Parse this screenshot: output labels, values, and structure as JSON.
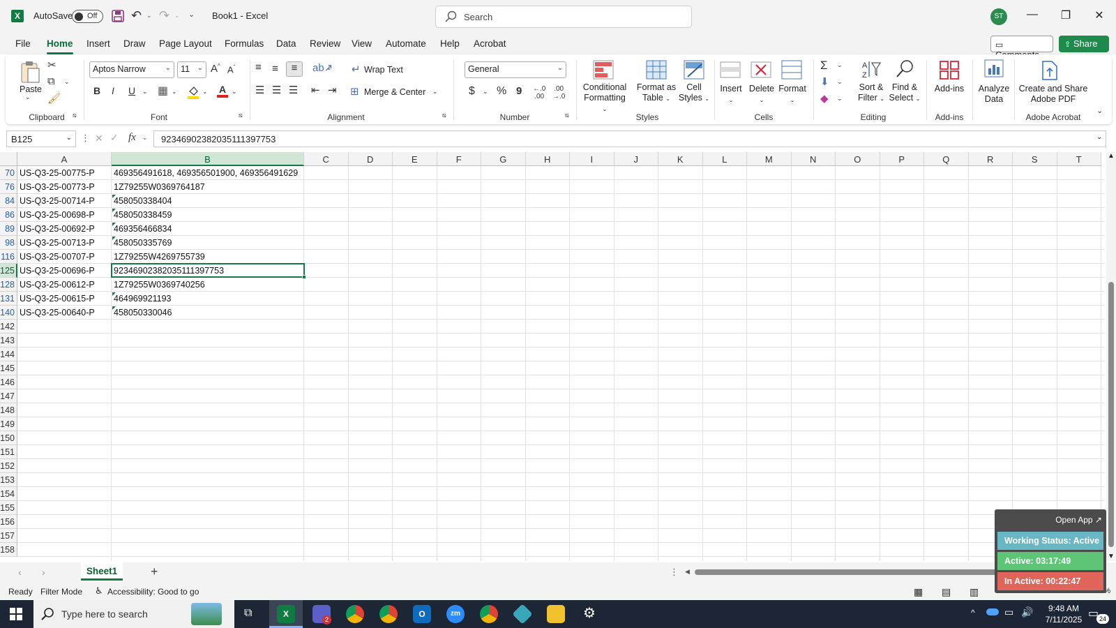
{
  "titlebar": {
    "autosave_label": "AutoSave",
    "autosave_state": "Off",
    "title": "Book1  -  Excel",
    "search_placeholder": "Search",
    "avatar_initials": "ST"
  },
  "menu": {
    "tabs": [
      "File",
      "Home",
      "Insert",
      "Draw",
      "Page Layout",
      "Formulas",
      "Data",
      "Review",
      "View",
      "Automate",
      "Help",
      "Acrobat"
    ],
    "active": "Home",
    "comments_label": "Comments",
    "share_label": "Share"
  },
  "ribbon": {
    "clipboard": {
      "paste": "Paste",
      "label": "Clipboard"
    },
    "font": {
      "name": "Aptos Narrow",
      "size": "11",
      "label": "Font",
      "bold": "B",
      "italic": "I",
      "underline": "U"
    },
    "alignment": {
      "wrap_text": "Wrap Text",
      "merge_center": "Merge & Center",
      "label": "Alignment"
    },
    "number": {
      "format": "General",
      "label": "Number",
      "currency": "$",
      "percent": "%",
      "comma": "9"
    },
    "styles": {
      "conditional_1": "Conditional",
      "conditional_2": "Formatting",
      "format_table_1": "Format as",
      "format_table_2": "Table",
      "cell_styles_1": "Cell",
      "cell_styles_2": "Styles",
      "label": "Styles"
    },
    "cells": {
      "insert": "Insert",
      "delete": "Delete",
      "format": "Format",
      "label": "Cells"
    },
    "editing": {
      "sort_1": "Sort &",
      "sort_2": "Filter",
      "find_1": "Find &",
      "find_2": "Select",
      "label": "Editing"
    },
    "addins": {
      "addins": "Add-ins",
      "label": "Add-ins"
    },
    "analyze": {
      "line1": "Analyze",
      "line2": "Data"
    },
    "acrobat": {
      "line1": "Create and Share",
      "line2": "Adobe PDF",
      "label": "Adobe Acrobat"
    }
  },
  "formula_bar": {
    "name_box": "B125",
    "fx": "fx",
    "value": "92346902382035111397753"
  },
  "columns": [
    "A",
    "B",
    "C",
    "D",
    "E",
    "F",
    "G",
    "H",
    "I",
    "J",
    "K",
    "L",
    "M",
    "N",
    "O",
    "P",
    "Q",
    "R",
    "S",
    "T"
  ],
  "selected_column": "B",
  "rows": [
    {
      "num": "70",
      "a": "US-Q3-25-00775-P",
      "b": "469356491618, 469356501900, 469356491629",
      "flag": false,
      "filtered": true
    },
    {
      "num": "76",
      "a": "US-Q3-25-00773-P",
      "b": "1Z79255W0369764187",
      "flag": false,
      "filtered": true
    },
    {
      "num": "84",
      "a": "US-Q3-25-00714-P",
      "b": "458050338404",
      "flag": true,
      "filtered": true
    },
    {
      "num": "86",
      "a": "US-Q3-25-00698-P",
      "b": "458050338459",
      "flag": true,
      "filtered": true
    },
    {
      "num": "89",
      "a": "US-Q3-25-00692-P",
      "b": "469356466834",
      "flag": true,
      "filtered": true
    },
    {
      "num": "98",
      "a": "US-Q3-25-00713-P",
      "b": "458050335769",
      "flag": true,
      "filtered": true
    },
    {
      "num": "116",
      "a": "US-Q3-25-00707-P",
      "b": "1Z79255W4269755739",
      "flag": false,
      "filtered": true
    },
    {
      "num": "125",
      "a": "US-Q3-25-00696-P",
      "b": "92346902382035111397753",
      "flag": false,
      "filtered": true,
      "selected": true
    },
    {
      "num": "128",
      "a": "US-Q3-25-00612-P",
      "b": "1Z79255W0369740256",
      "flag": false,
      "filtered": true
    },
    {
      "num": "131",
      "a": "US-Q3-25-00615-P",
      "b": "464969921193",
      "flag": true,
      "filtered": true
    },
    {
      "num": "140",
      "a": "US-Q3-25-00640-P",
      "b": "458050330046",
      "flag": true,
      "filtered": true
    },
    {
      "num": "142",
      "a": "",
      "b": "",
      "flag": false,
      "filtered": false
    },
    {
      "num": "143",
      "a": "",
      "b": "",
      "flag": false,
      "filtered": false
    },
    {
      "num": "144",
      "a": "",
      "b": "",
      "flag": false,
      "filtered": false
    },
    {
      "num": "145",
      "a": "",
      "b": "",
      "flag": false,
      "filtered": false
    },
    {
      "num": "146",
      "a": "",
      "b": "",
      "flag": false,
      "filtered": false
    },
    {
      "num": "147",
      "a": "",
      "b": "",
      "flag": false,
      "filtered": false
    },
    {
      "num": "148",
      "a": "",
      "b": "",
      "flag": false,
      "filtered": false
    },
    {
      "num": "149",
      "a": "",
      "b": "",
      "flag": false,
      "filtered": false
    },
    {
      "num": "150",
      "a": "",
      "b": "",
      "flag": false,
      "filtered": false
    },
    {
      "num": "151",
      "a": "",
      "b": "",
      "flag": false,
      "filtered": false
    },
    {
      "num": "152",
      "a": "",
      "b": "",
      "flag": false,
      "filtered": false
    },
    {
      "num": "153",
      "a": "",
      "b": "",
      "flag": false,
      "filtered": false
    },
    {
      "num": "154",
      "a": "",
      "b": "",
      "flag": false,
      "filtered": false
    },
    {
      "num": "155",
      "a": "",
      "b": "",
      "flag": false,
      "filtered": false
    },
    {
      "num": "156",
      "a": "",
      "b": "",
      "flag": false,
      "filtered": false
    },
    {
      "num": "157",
      "a": "",
      "b": "",
      "flag": false,
      "filtered": false
    },
    {
      "num": "158",
      "a": "",
      "b": "",
      "flag": false,
      "filtered": false
    }
  ],
  "sheet_tabs": {
    "tabs": [
      "Sheet1"
    ],
    "active": "Sheet1"
  },
  "status": {
    "ready": "Ready",
    "mode": "Filter Mode",
    "accessibility": "Accessibility: Good to go",
    "zoom": "100%"
  },
  "widget": {
    "open_app": "Open App ↗",
    "working_status": "Working Status: Active",
    "active": "Active: 03:17:49",
    "inactive": "In Active: 00:22:47",
    "colors": {
      "status": "#67b8c4",
      "active": "#5ec576",
      "inactive": "#e0645a"
    }
  },
  "taskbar": {
    "search_placeholder": "Type here to search",
    "time": "9:48 AM",
    "date": "7/11/2025",
    "notification_count": "24",
    "teams_badge": "2"
  },
  "colors": {
    "excel_green": "#107c41",
    "share_green": "#1e8a4c",
    "row_number_blue": "#1f5ea8"
  }
}
